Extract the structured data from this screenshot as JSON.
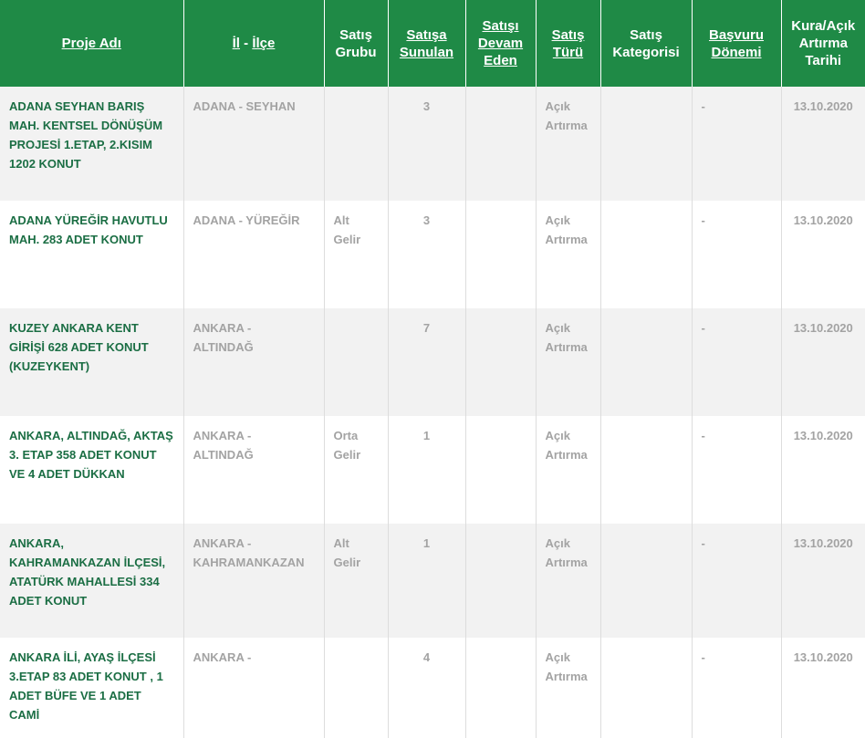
{
  "headers": [
    {
      "label": "Proje Adı",
      "sortable": true
    },
    {
      "label": "İl",
      "sep": " - ",
      "label2": "İlçe",
      "sortable": true
    },
    {
      "label": "Satış Grubu",
      "sortable": false
    },
    {
      "label": "Satışa Sunulan",
      "sortable": true
    },
    {
      "label": "Satışı Devam Eden",
      "sortable": true
    },
    {
      "label": "Satış Türü",
      "sortable": true
    },
    {
      "label": "Satış Kategorisi",
      "sortable": false
    },
    {
      "label": "Başvuru Dönemi",
      "sortable": true
    },
    {
      "label": "Kura/Açık Artırma Tarihi",
      "sortable": false
    }
  ],
  "rows": [
    {
      "name": "ADANA SEYHAN BARIŞ MAH. KENTSEL DÖNÜŞÜM PROJESİ 1.ETAP, 2.KISIM 1202 KONUT",
      "location": "ADANA - SEYHAN",
      "group": "",
      "offered": "3",
      "ongoing": "",
      "type": "Açık Artırma",
      "category": "",
      "period": "-",
      "date": "13.10.2020"
    },
    {
      "name": "ADANA YÜREĞİR HAVUTLU MAH. 283 ADET KONUT",
      "location": "ADANA - YÜREĞİR",
      "group": "Alt Gelir",
      "offered": "3",
      "ongoing": "",
      "type": "Açık Artırma",
      "category": "",
      "period": "-",
      "date": "13.10.2020"
    },
    {
      "name": "KUZEY ANKARA KENT GİRİŞİ 628 ADET KONUT (KUZEYKENT)",
      "location": "ANKARA - ALTINDAĞ",
      "group": "",
      "offered": "7",
      "ongoing": "",
      "type": "Açık Artırma",
      "category": "",
      "period": "-",
      "date": "13.10.2020"
    },
    {
      "name": "ANKARA, ALTINDAĞ, AKTAŞ 3. ETAP 358 ADET KONUT VE 4 ADET DÜKKAN",
      "location": "ANKARA - ALTINDAĞ",
      "group": "Orta Gelir",
      "offered": "1",
      "ongoing": "",
      "type": "Açık Artırma",
      "category": "",
      "period": "-",
      "date": "13.10.2020"
    },
    {
      "name": "ANKARA, KAHRAMANKAZAN İLÇESİ, ATATÜRK MAHALLESİ 334 ADET KONUT",
      "location": "ANKARA - KAHRAMANKAZAN",
      "group": "Alt Gelir",
      "offered": "1",
      "ongoing": "",
      "type": "Açık Artırma",
      "category": "",
      "period": "-",
      "date": "13.10.2020"
    },
    {
      "name": "ANKARA İLİ, AYAŞ İLÇESİ 3.ETAP 83 ADET KONUT , 1 ADET BÜFE VE 1 ADET CAMİ",
      "location": "ANKARA -",
      "group": "",
      "offered": "4",
      "ongoing": "",
      "type": "Açık Artırma",
      "category": "",
      "period": "-",
      "date": "13.10.2020"
    }
  ]
}
